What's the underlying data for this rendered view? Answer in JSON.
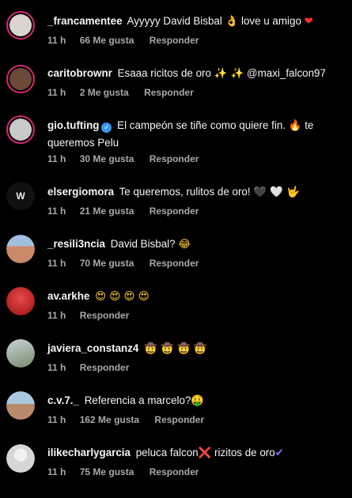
{
  "comments": [
    {
      "username": "_francamentee",
      "text": "Ayyyyy David Bisbal ",
      "emoji1": "👌",
      "text2": " love u amigo ",
      "emoji2": "❤",
      "time": "11 h",
      "likes": "66 Me gusta",
      "reply": "Responder",
      "avatar_color": "#d9d4cf"
    },
    {
      "username": "caritobrownr",
      "text": "Esaaa ricitos de oro ",
      "emoji1": "✨ ✨",
      "mention": "@maxi_falcon97",
      "time": "11 h",
      "likes": "2 Me gusta",
      "reply": "Responder",
      "avatar_color": "#6b4a3a"
    },
    {
      "username": "gio.tufting",
      "text": "El campeón se tiñe como quiere fin. ",
      "emoji1": "🔥",
      "text2": " te queremos Pelu",
      "time": "11 h",
      "likes": "30 Me gusta",
      "reply": "Responder",
      "avatar_color": "#c9c9c9"
    },
    {
      "username": "elsergiomora",
      "text": "Te queremos, rulitos de oro! ",
      "emoji1": "🖤 🤍 🤟",
      "time": "11 h",
      "likes": "21 Me gusta",
      "reply": "Responder",
      "avatar_color": "#111111"
    },
    {
      "username": "_resili3ncia",
      "text": "David Bisbal? ",
      "emoji1": "😂",
      "time": "11 h",
      "likes": "70 Me gusta",
      "reply": "Responder",
      "avatar_color": "#c98a6a"
    },
    {
      "username": "av.arkhe",
      "text": "",
      "emoji1": "😍 😍 😍 😍",
      "time": "11 h",
      "reply": "Responder",
      "avatar_color": "#c42020"
    },
    {
      "username": "javiera_constanz4",
      "text": "",
      "emoji1": "🤠 🤠 🤠 🤠",
      "time": "11 h",
      "reply": "Responder",
      "avatar_color": "#7a8a6a"
    },
    {
      "username": "c.v.7._",
      "text": "Referencia a marcelo?",
      "emoji1": "🤑",
      "time": "11 h",
      "likes": "162 Me gusta",
      "reply": "Responder",
      "avatar_color": "#8ab0c8"
    },
    {
      "username": "ilikecharlygarcia",
      "text": "peluca falcon",
      "emoji1": "❌",
      "text2": " rizitos de oro",
      "emoji2": "✔",
      "time": "11 h",
      "likes": "75 Me gusta",
      "reply": "Responder",
      "avatar_color": "#e0e0e0"
    }
  ]
}
